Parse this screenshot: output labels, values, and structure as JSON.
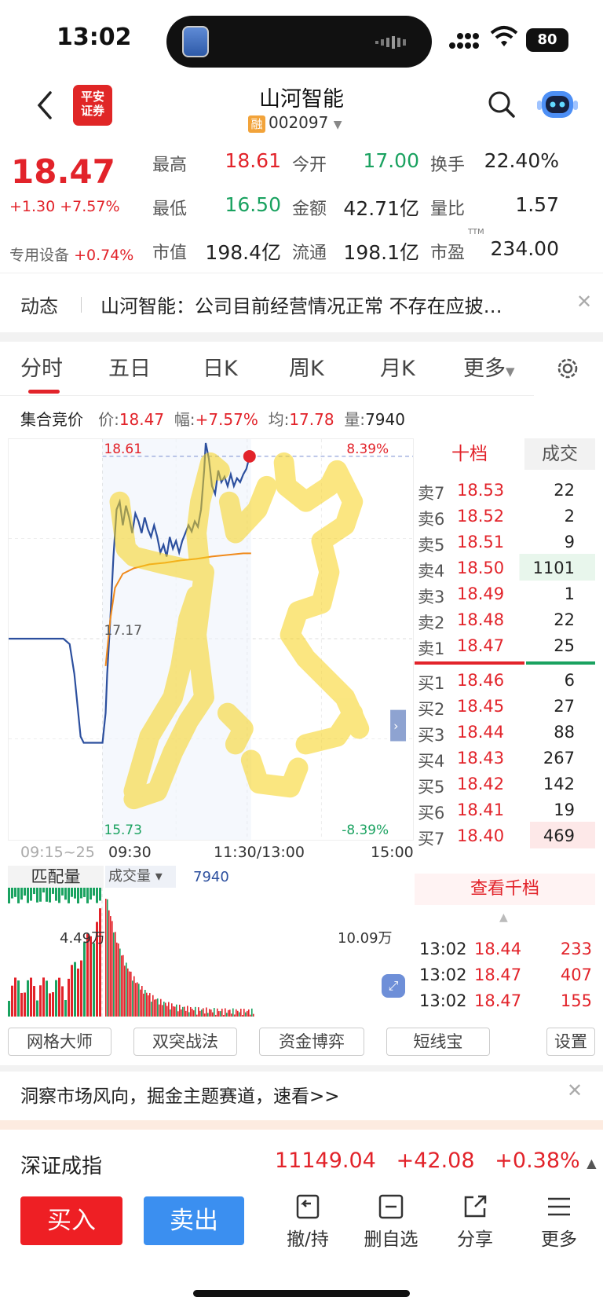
{
  "status_bar": {
    "time": "13:02",
    "battery": "80"
  },
  "header": {
    "stock_name": "山河智能",
    "badge": "融",
    "stock_code": "002097",
    "logo_line1": "平安",
    "logo_line2": "证券"
  },
  "quote": {
    "price": "18.47",
    "change": "+1.30 +7.57%",
    "sector_name": "专用设备",
    "sector_change": "+0.74%",
    "fields": [
      {
        "label": "最高",
        "value": "18.61",
        "color": "#e2232a"
      },
      {
        "label": "今开",
        "value": "17.00",
        "color": "#1aa260"
      },
      {
        "label": "换手",
        "value": "22.40%",
        "color": "#222222"
      },
      {
        "label": "最低",
        "value": "16.50",
        "color": "#1aa260"
      },
      {
        "label": "金额",
        "value": "42.71亿",
        "color": "#222222"
      },
      {
        "label": "量比",
        "value": "1.57",
        "color": "#222222"
      },
      {
        "label": "市值",
        "value": "198.4亿",
        "color": "#222222"
      },
      {
        "label": "流通",
        "value": "198.1亿",
        "color": "#222222"
      },
      {
        "label": "市盈",
        "value": "234.00",
        "color": "#222222"
      }
    ],
    "pe_sup": "TTM"
  },
  "news": {
    "tag": "动态",
    "text": "山河智能：公司目前经营情况正常 不存在应披…"
  },
  "tabs": [
    "分时",
    "五日",
    "日K",
    "周K",
    "月K",
    "更多"
  ],
  "auction": {
    "label": "集合竞价",
    "price_label": "价:",
    "price": "18.47",
    "range_label": "幅:",
    "range": "+7.57%",
    "avg_label": "均:",
    "avg": "17.78",
    "vol_label": "量:",
    "vol": "7940"
  },
  "chart": {
    "high_label": "18.61",
    "high_pct": "8.39%",
    "mid_label": "17.17",
    "low_label": "15.73",
    "low_pct": "-8.39%",
    "time_labels": [
      "09:15~25",
      "09:30",
      "11:30/13:00",
      "15:00"
    ],
    "vol_tab1": "匹配量",
    "vol_tab2": "成交量 ▾",
    "vol_value": "7940",
    "vol_left_label": "4.49万",
    "vol_right_label": "10.09万"
  },
  "orderbook": {
    "tab1": "十档",
    "tab2": "成交",
    "asks": [
      {
        "label": "卖7",
        "price": "18.53",
        "vol": "22"
      },
      {
        "label": "卖6",
        "price": "18.52",
        "vol": "2"
      },
      {
        "label": "卖5",
        "price": "18.51",
        "vol": "9"
      },
      {
        "label": "卖4",
        "price": "18.50",
        "vol": "1101"
      },
      {
        "label": "卖3",
        "price": "18.49",
        "vol": "1"
      },
      {
        "label": "卖2",
        "price": "18.48",
        "vol": "22"
      },
      {
        "label": "卖1",
        "price": "18.47",
        "vol": "25"
      }
    ],
    "bids": [
      {
        "label": "买1",
        "price": "18.46",
        "vol": "6"
      },
      {
        "label": "买2",
        "price": "18.45",
        "vol": "27"
      },
      {
        "label": "买3",
        "price": "18.44",
        "vol": "88"
      },
      {
        "label": "买4",
        "price": "18.43",
        "vol": "267"
      },
      {
        "label": "买5",
        "price": "18.42",
        "vol": "142"
      },
      {
        "label": "买6",
        "price": "18.41",
        "vol": "19"
      },
      {
        "label": "买7",
        "price": "18.40",
        "vol": "469"
      }
    ],
    "depth_button": "查看千档",
    "trades": [
      {
        "time": "13:02",
        "price": "18.44",
        "vol": "233"
      },
      {
        "time": "13:02",
        "price": "18.47",
        "vol": "407"
      },
      {
        "time": "13:02",
        "price": "18.47",
        "vol": "155"
      }
    ]
  },
  "tools": [
    "网格大师",
    "双突战法",
    "资金博弈",
    "短线宝",
    "设置"
  ],
  "promo": {
    "text": "洞察市场风向，掘金主题赛道，速看>>"
  },
  "index": {
    "name": "深证成指",
    "value": "11149.04",
    "change": "+42.08",
    "pct": "+0.38%"
  },
  "actions": {
    "buy": "买入",
    "sell": "卖出",
    "cancel": "撤/持",
    "remove": "删自选",
    "share": "分享",
    "more": "更多"
  },
  "colors": {
    "up": "#e2232a",
    "down": "#1aa260",
    "buy_btn": "#ee1f24",
    "sell_btn": "#3b8ff0",
    "price_line": "#2c4f9e",
    "avg_line": "#f08a1c"
  }
}
